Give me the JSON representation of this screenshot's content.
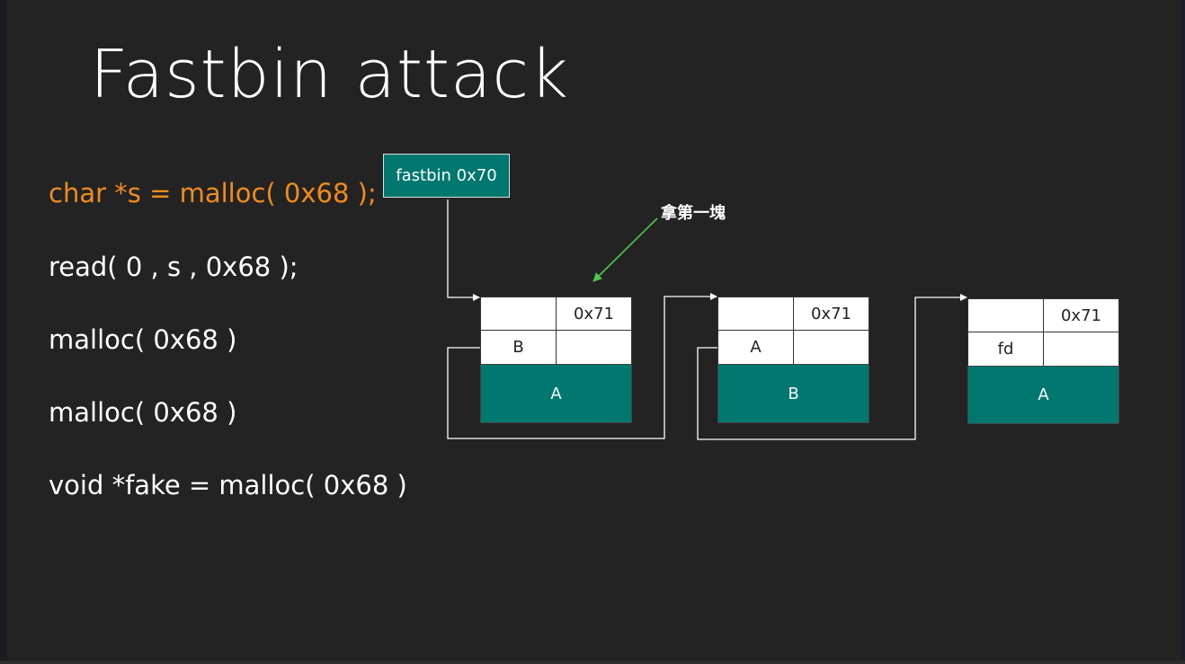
{
  "title": "Fastbin attack",
  "code_lines": [
    "char *s = malloc( 0x68 );",
    "read( 0 , s , 0x68 );",
    "malloc( 0x68 )",
    "malloc( 0x68 )",
    "void *fake = malloc( 0x68 )"
  ],
  "fastbin_label": "fastbin 0x70",
  "annotation": "拿第一塊",
  "chunks": [
    {
      "size": "0x71",
      "fd": "B",
      "name": "A"
    },
    {
      "size": "0x71",
      "fd": "A",
      "name": "B"
    },
    {
      "size": "0x71",
      "fd": "fd",
      "name": "A"
    }
  ],
  "colors": {
    "background": "#232323",
    "highlight": "#f08c1e",
    "chunk_fill": "#007870",
    "arrow_green": "#4ec94e"
  }
}
